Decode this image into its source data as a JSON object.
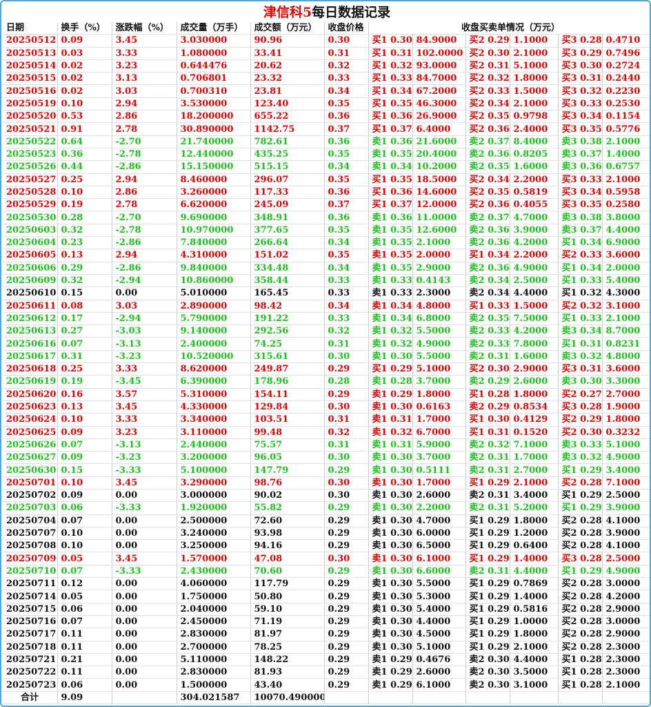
{
  "title": {
    "main": "津信科5",
    "suffix": "每日数据记录"
  },
  "headers": [
    "日期",
    "换手（%）",
    "涨跌幅（%）",
    "成交量（万手）",
    "成交额（万元）",
    "收盘价格",
    "收盘买卖单情况（万元）"
  ],
  "colors": {
    "up": "#e00000",
    "down": "#1ec01e",
    "flat": "#111111",
    "frame": "#4fa8d8"
  },
  "rows": [
    {
      "t": "up",
      "c": [
        "20250512",
        "0.09",
        "3.45",
        "3.030000",
        "90.96",
        "0.30",
        "买1 0.30",
        "84.9000",
        "买2 0.29",
        "1.1000",
        "买3 0.28",
        "0.4710"
      ]
    },
    {
      "t": "up",
      "c": [
        "20250513",
        "0.03",
        "3.33",
        "1.080000",
        "33.41",
        "0.31",
        "买1 0.31",
        "102.0000",
        "买2 0.30",
        "2.1000",
        "买3 0.29",
        "0.7496"
      ]
    },
    {
      "t": "up",
      "c": [
        "20250514",
        "0.02",
        "3.23",
        "0.644476",
        "20.62",
        "0.32",
        "买1 0.32",
        "93.0000",
        "买2 0.31",
        "5.1000",
        "买3 0.30",
        "0.2724"
      ]
    },
    {
      "t": "up",
      "c": [
        "20250515",
        "0.02",
        "3.13",
        "0.706801",
        "23.32",
        "0.33",
        "买1 0.33",
        "84.7000",
        "买2 0.32",
        "1.8000",
        "买3 0.31",
        "0.2440"
      ]
    },
    {
      "t": "up",
      "c": [
        "20250516",
        "0.02",
        "3.03",
        "0.700310",
        "23.81",
        "0.34",
        "买1 0.34",
        "67.2000",
        "买2 0.33",
        "1.5000",
        "买3 0.32",
        "0.2230"
      ]
    },
    {
      "t": "up",
      "c": [
        "20250519",
        "0.10",
        "2.94",
        "3.530000",
        "123.40",
        "0.35",
        "买1 0.35",
        "46.3000",
        "买2 0.34",
        "2.1000",
        "买3 0.33",
        "0.2530"
      ]
    },
    {
      "t": "up",
      "c": [
        "20250520",
        "0.53",
        "2.86",
        "18.200000",
        "655.22",
        "0.36",
        "买1 0.36",
        "26.9000",
        "买2 0.35",
        "0.9798",
        "买3 0.34",
        "0.1154"
      ]
    },
    {
      "t": "up",
      "c": [
        "20250521",
        "0.91",
        "2.78",
        "30.890000",
        "1142.75",
        "0.37",
        "买1 0.37",
        "6.4000",
        "买2 0.36",
        "2.4000",
        "买3 0.35",
        "0.5776"
      ]
    },
    {
      "t": "down",
      "c": [
        "20250522",
        "0.64",
        "-2.70",
        "21.740000",
        "782.61",
        "0.36",
        "卖1 0.36",
        "21.6000",
        "卖2 0.37",
        "8.4000",
        "卖3 0.38",
        "2.1000"
      ]
    },
    {
      "t": "down",
      "c": [
        "20250523",
        "0.36",
        "-2.78",
        "12.440000",
        "435.25",
        "0.35",
        "卖1 0.35",
        "20.4000",
        "卖2 0.36",
        "0.8205",
        "卖3 0.37",
        "1.4000"
      ]
    },
    {
      "t": "down",
      "c": [
        "20250526",
        "0.44",
        "-2.86",
        "15.150000",
        "515.15",
        "0.34",
        "卖1 0.34",
        "10.2000",
        "卖2 0.35",
        "1.6000",
        "卖3 0.36",
        "0.6757"
      ]
    },
    {
      "t": "up",
      "c": [
        "20250527",
        "0.25",
        "2.94",
        "8.460000",
        "296.07",
        "0.35",
        "买1 0.35",
        "18.5000",
        "买2 0.34",
        "2.2000",
        "买3 0.33",
        "2.1000"
      ]
    },
    {
      "t": "up",
      "c": [
        "20250528",
        "0.10",
        "2.86",
        "3.260000",
        "117.33",
        "0.36",
        "买1 0.36",
        "14.6000",
        "买2 0.35",
        "0.5819",
        "买3 0.34",
        "0.5958"
      ]
    },
    {
      "t": "up",
      "c": [
        "20250529",
        "0.19",
        "2.78",
        "6.620000",
        "245.09",
        "0.37",
        "买1 0.37",
        "12.0000",
        "买2 0.36",
        "0.4055",
        "买3 0.35",
        "0.2580"
      ]
    },
    {
      "t": "down",
      "c": [
        "20250530",
        "0.28",
        "-2.70",
        "9.690000",
        "348.91",
        "0.36",
        "卖1 0.36",
        "11.0000",
        "卖2 0.37",
        "4.7000",
        "卖3 0.38",
        "3.8000"
      ]
    },
    {
      "t": "down",
      "c": [
        "20250603",
        "0.32",
        "-2.78",
        "10.970000",
        "377.65",
        "0.35",
        "卖1 0.35",
        "12.6000",
        "卖2 0.36",
        "3.9000",
        "卖3 0.37",
        "4.4000"
      ]
    },
    {
      "t": "down",
      "c": [
        "20250604",
        "0.23",
        "-2.86",
        "7.840000",
        "266.64",
        "0.34",
        "卖1 0.35",
        "2.1000",
        "卖2 0.36",
        "4.2000",
        "买1 0.34",
        "6.9000"
      ]
    },
    {
      "t": "up",
      "c": [
        "20250605",
        "0.13",
        "2.94",
        "4.310000",
        "151.02",
        "0.35",
        "卖1 0.35",
        "2.0000",
        "买1 0.34",
        "2.2000",
        "买2 0.33",
        "3.6000"
      ]
    },
    {
      "t": "down",
      "c": [
        "20250606",
        "0.29",
        "-2.86",
        "9.840000",
        "334.48",
        "0.34",
        "卖1 0.35",
        "2.9000",
        "卖2 0.36",
        "4.9000",
        "买1 0.34",
        "2.0000"
      ]
    },
    {
      "t": "down",
      "c": [
        "20250609",
        "0.32",
        "-2.94",
        "10.860000",
        "358.44",
        "0.33",
        "卖1 0.33",
        "0.4143",
        "卖2 0.34",
        "2.5000",
        "买1 0.33",
        "5.4000"
      ]
    },
    {
      "t": "flat",
      "c": [
        "20250610",
        "0.15",
        "0.00",
        "5.010000",
        "165.45",
        "0.33",
        "卖1 0.33",
        "2.3000",
        "卖2 0.34",
        "4.4000",
        "买1 0.32",
        "4.3000"
      ]
    },
    {
      "t": "up",
      "c": [
        "20250611",
        "0.08",
        "3.03",
        "2.890000",
        "98.42",
        "0.34",
        "卖1 0.34",
        "4.8000",
        "买1 0.33",
        "1.5000",
        "买2 0.32",
        "3.1000"
      ]
    },
    {
      "t": "down",
      "c": [
        "20250612",
        "0.17",
        "-2.94",
        "5.790000",
        "191.22",
        "0.33",
        "卖1 0.34",
        "6.8000",
        "卖2 0.35",
        "7.5000",
        "买1 0.33",
        "2.1000"
      ]
    },
    {
      "t": "down",
      "c": [
        "20250613",
        "0.27",
        "-3.03",
        "9.140000",
        "292.56",
        "0.32",
        "卖1 0.32",
        "5.5000",
        "卖2 0.33",
        "4.2000",
        "卖3 0.34",
        "8.7000"
      ]
    },
    {
      "t": "down",
      "c": [
        "20250616",
        "0.07",
        "-3.13",
        "2.400000",
        "74.25",
        "0.31",
        "卖1 0.32",
        "4.9000",
        "卖2 0.33",
        "7.8000",
        "买1 0.31",
        "0.8231"
      ]
    },
    {
      "t": "down",
      "c": [
        "20250617",
        "0.31",
        "-3.23",
        "10.520000",
        "315.61",
        "0.30",
        "卖1 0.30",
        "5.5000",
        "卖2 0.31",
        "1.6000",
        "卖3 0.32",
        "4.8000"
      ]
    },
    {
      "t": "up",
      "c": [
        "20250618",
        "0.25",
        "3.33",
        "8.620000",
        "249.87",
        "0.29",
        "买1 0.29",
        "5.1000",
        "买2 0.30",
        "2.9000",
        "买3 0.31",
        "3.6000"
      ]
    },
    {
      "t": "down",
      "c": [
        "20250619",
        "0.19",
        "-3.45",
        "6.390000",
        "178.96",
        "0.28",
        "卖1 0.28",
        "3.7000",
        "卖2 0.29",
        "2.6000",
        "卖3 0.30",
        "3.3000"
      ]
    },
    {
      "t": "up",
      "c": [
        "20250620",
        "0.16",
        "3.57",
        "5.310000",
        "154.11",
        "0.29",
        "卖1 0.29",
        "1.8000",
        "买1 0.28",
        "1.8000",
        "买2 0.27",
        "2.7000"
      ]
    },
    {
      "t": "up",
      "c": [
        "20250623",
        "0.13",
        "3.45",
        "4.330000",
        "129.84",
        "0.30",
        "卖1 0.30",
        "0.6163",
        "卖2 0.29",
        "0.8534",
        "买3 0.28",
        "1.9000"
      ]
    },
    {
      "t": "up",
      "c": [
        "20250624",
        "0.10",
        "3.33",
        "3.340000",
        "103.51",
        "0.31",
        "卖1 0.31",
        "1.7000",
        "买1 0.30",
        "0.4129",
        "买2 0.29",
        "1.8000"
      ]
    },
    {
      "t": "up",
      "c": [
        "20250625",
        "0.09",
        "3.23",
        "3.110000",
        "99.48",
        "0.32",
        "卖1 0.32",
        "6.7000",
        "买1 0.31",
        "0.1520",
        "买2 0.30",
        "0.3232"
      ]
    },
    {
      "t": "down",
      "c": [
        "20250626",
        "0.07",
        "-3.13",
        "2.440000",
        "75.57",
        "0.31",
        "卖1 0.31",
        "5.9000",
        "卖2 0.32",
        "7.1000",
        "卖3 0.33",
        "5.1000"
      ]
    },
    {
      "t": "down",
      "c": [
        "20250627",
        "0.09",
        "-3.23",
        "3.200000",
        "96.05",
        "0.30",
        "卖1 0.30",
        "3.7000",
        "卖2 0.31",
        "1.7000",
        "卖3 0.32",
        "4.9000"
      ]
    },
    {
      "t": "down",
      "c": [
        "20250630",
        "0.15",
        "-3.33",
        "5.100000",
        "147.79",
        "0.29",
        "卖1 0.30",
        "0.5111",
        "卖2 0.31",
        "2.7000",
        "买1 0.29",
        "3.4000"
      ]
    },
    {
      "t": "up",
      "c": [
        "20250701",
        "0.10",
        "3.45",
        "3.290000",
        "98.76",
        "0.30",
        "卖1 0.30",
        "1.7000",
        "买1 0.29",
        "2.1000",
        "买2 0.28",
        "7.1000"
      ]
    },
    {
      "t": "flat",
      "c": [
        "20250702",
        "0.09",
        "0.00",
        "3.000000",
        "90.02",
        "0.30",
        "卖1 0.30",
        "2.6000",
        "卖2 0.31",
        "3.4000",
        "买1 0.29",
        "2.5000"
      ]
    },
    {
      "t": "down",
      "c": [
        "20250703",
        "0.06",
        "-3.33",
        "1.920000",
        "55.82",
        "0.29",
        "卖1 0.30",
        "2.2000",
        "卖2 0.31",
        "5.2000",
        "买1 0.29",
        "3.9000"
      ]
    },
    {
      "t": "flat",
      "c": [
        "20250704",
        "0.07",
        "0.00",
        "2.500000",
        "72.60",
        "0.29",
        "卖1 0.30",
        "4.7000",
        "买1 0.29",
        "1.8000",
        "买2 0.28",
        "4.1000"
      ]
    },
    {
      "t": "flat",
      "c": [
        "20250707",
        "0.10",
        "0.00",
        "3.240000",
        "93.98",
        "0.29",
        "卖1 0.30",
        "6.0000",
        "买1 0.29",
        "1.2000",
        "买2 0.28",
        "3.9000"
      ]
    },
    {
      "t": "flat",
      "c": [
        "20250708",
        "0.10",
        "0.00",
        "3.250000",
        "94.16",
        "0.29",
        "卖1 0.30",
        "6.5000",
        "买1 0.29",
        "0.6400",
        "买2 0.28",
        "4.1000"
      ]
    },
    {
      "t": "up",
      "c": [
        "20250709",
        "0.05",
        "3.45",
        "1.570000",
        "47.08",
        "0.30",
        "卖1 0.30",
        "6.1000",
        "买1 0.29",
        "1.4000",
        "买3 0.28",
        "2.5000"
      ]
    },
    {
      "t": "down",
      "c": [
        "20250710",
        "0.07",
        "-3.33",
        "2.430000",
        "70.60",
        "0.29",
        "卖1 0.30",
        "6.6000",
        "卖2 0.31",
        "4.4000",
        "买1 0.29",
        "4.9000"
      ]
    },
    {
      "t": "flat",
      "c": [
        "20250711",
        "0.12",
        "0.00",
        "4.060000",
        "117.79",
        "0.29",
        "卖1 0.30",
        "5.5000",
        "买1 0.29",
        "0.7869",
        "买2 0.28",
        "3.0000"
      ]
    },
    {
      "t": "flat",
      "c": [
        "20250714",
        "0.05",
        "0.00",
        "1.750000",
        "50.80",
        "0.29",
        "卖1 0.30",
        "5.3000",
        "买1 0.29",
        "1.4000",
        "买2 0.28",
        "4.2000"
      ]
    },
    {
      "t": "flat",
      "c": [
        "20250715",
        "0.06",
        "0.00",
        "2.040000",
        "59.10",
        "0.29",
        "卖1 0.30",
        "5.4000",
        "买1 0.29",
        "0.5816",
        "买2 0.28",
        "2.9000"
      ]
    },
    {
      "t": "flat",
      "c": [
        "20250716",
        "0.07",
        "0.00",
        "2.450000",
        "71.19",
        "0.29",
        "卖1 0.30",
        "4.4000",
        "买1 0.29",
        "1.0000",
        "买2 0.28",
        "3.0000"
      ]
    },
    {
      "t": "flat",
      "c": [
        "20250717",
        "0.11",
        "0.00",
        "2.830000",
        "81.97",
        "0.29",
        "卖1 0.30",
        "4.5000",
        "买1 0.29",
        "1.8000",
        "买2 0.28",
        "2.9000"
      ]
    },
    {
      "t": "flat",
      "c": [
        "20250718",
        "0.11",
        "0.00",
        "2.700000",
        "78.25",
        "0.29",
        "卖1 0.30",
        "5.1000",
        "买1 0.29",
        "2.1000",
        "买2 0.28",
        "2.3000"
      ]
    },
    {
      "t": "flat",
      "c": [
        "20250721",
        "0.21",
        "0.00",
        "5.110000",
        "148.22",
        "0.29",
        "卖1 0.29",
        "0.4676",
        "卖2 0.30",
        "4.4000",
        "买1 0.28",
        "2.3000"
      ]
    },
    {
      "t": "flat",
      "c": [
        "20250722",
        "0.11",
        "0.00",
        "2.830000",
        "81.93",
        "0.29",
        "卖1 0.29",
        "2.6000",
        "卖2 0.30",
        "3.5000",
        "买1 0.28",
        "2.3000"
      ]
    },
    {
      "t": "flat",
      "c": [
        "20250723",
        "0.06",
        "0.00",
        "1.500000",
        "43.40",
        "0.29",
        "卖1 0.29",
        "6.1000",
        "卖2 0.30",
        "3.1000",
        "买1 0.28",
        "2.1000"
      ]
    }
  ],
  "total": {
    "label": "合计",
    "turnover": "9.09",
    "volume": "304.021587",
    "amount": "10070.490000"
  }
}
